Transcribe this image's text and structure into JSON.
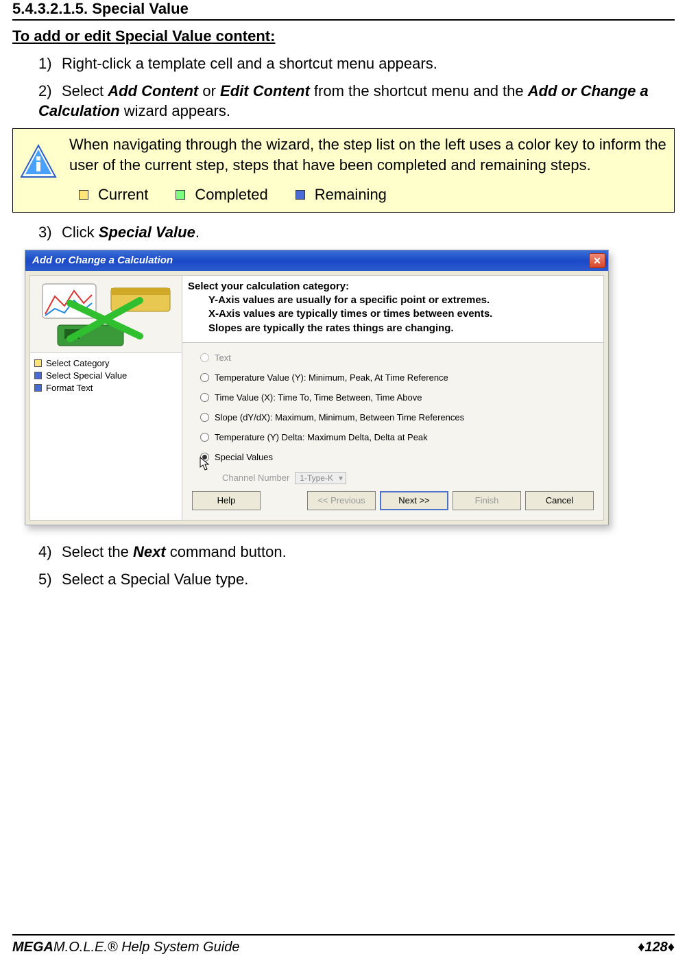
{
  "section_number": "5.4.3.2.1.5. Special Value",
  "sub_heading": "To add or edit Special Value content:",
  "steps": {
    "s1": {
      "num": "1)",
      "text": "Right-click a template cell and a shortcut menu appears."
    },
    "s2": {
      "num": "2)",
      "pre": "Select ",
      "add_content": "Add Content",
      "or": " or ",
      "edit_content": "Edit Content",
      "mid": " from the shortcut menu and the ",
      "wizard_name": "Add or Change a Calculation",
      "post": " wizard appears."
    },
    "s3": {
      "num": "3)",
      "pre": "Click ",
      "sv": "Special Value",
      "post": "."
    },
    "s4": {
      "num": "4)",
      "pre": "Select the ",
      "next": "Next",
      "post": " command button."
    },
    "s5": {
      "num": "5)",
      "text": "Select a Special Value type."
    }
  },
  "note": {
    "body": "When navigating through the wizard, the step list on the left uses a color key to inform the user of the current step, steps that have been completed and remaining steps.",
    "legend": {
      "current": "Current",
      "completed": "Completed",
      "remaining": "Remaining"
    }
  },
  "wizard": {
    "title": "Add or Change a Calculation",
    "steps": {
      "s1": "Select Category",
      "s2": "Select Special Value",
      "s3": "Format Text"
    },
    "header": {
      "line1": "Select your calculation category:",
      "line2": "Y-Axis values are usually for a specific point or extremes.",
      "line3": "X-Axis values are typically times or times between events.",
      "line4": "Slopes are typically the rates things are changing."
    },
    "options": {
      "text": "Text",
      "tempy": "Temperature Value (Y):  Minimum, Peak, At Time Reference",
      "timex": "Time Value (X):  Time To, Time Between, Time Above",
      "slope": "Slope (dY/dX):  Maximum, Minimum, Between Time References",
      "tdy": "Temperature (Y) Delta:  Maximum Delta, Delta at Peak",
      "sv": "Special  Values",
      "chan_label": "Channel Number",
      "chan_value": "1-Type-K"
    },
    "buttons": {
      "help": "Help",
      "prev": "<< Previous",
      "next": "Next >>",
      "finish": "Finish",
      "cancel": "Cancel"
    }
  },
  "footer": {
    "mega": "MEGA",
    "rest": "M.O.L.E.® Help System Guide",
    "page": "♦128♦"
  }
}
